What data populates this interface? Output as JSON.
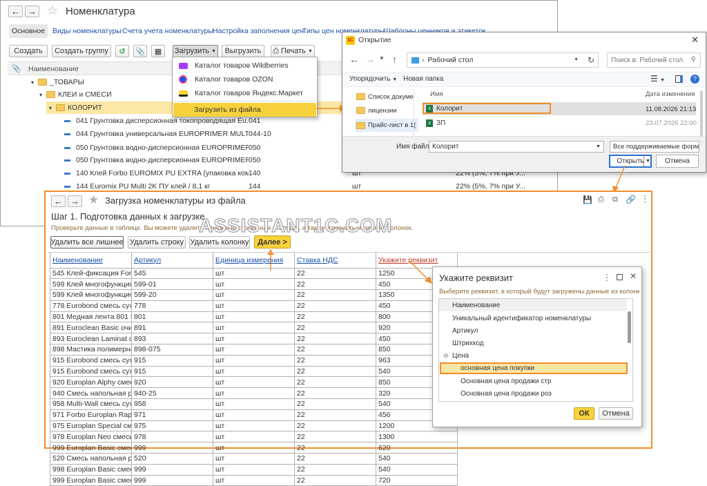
{
  "main": {
    "title": "Номенклатура",
    "tabs": [
      "Основное",
      "Виды номенклатуры",
      "Счета учета номенклатуры",
      "Настройка заполнения цен",
      "Типы цен номенклатуры",
      "Шаблоны ценников и этикеток"
    ],
    "toolbar": {
      "create": "Создать",
      "create_group": "Создать группу",
      "load": "Загрузить",
      "unload": "Выгрузить",
      "print": "Печать"
    },
    "column_name": "Наименование",
    "tree": [
      {
        "label": "_ТОВАРЫ",
        "level": 0
      },
      {
        "label": "КЛЕИ и СМЕСИ",
        "level": 1
      },
      {
        "label": "КОЛОРИТ",
        "level": 2
      }
    ],
    "items": [
      {
        "name": "041 Грунтовка дисперсионная токопроводящая  Eu...",
        "code": "041",
        "unit": "",
        "vat": ""
      },
      {
        "name": "044 Грунтовка универсальная EUROPRIMER MULTI ...",
        "code": "044-10",
        "unit": "",
        "vat": ""
      },
      {
        "name": "050 Грунтовка водно-дисперсионная EUROPRIMER...",
        "code": "050",
        "unit": "",
        "vat": ""
      },
      {
        "name": "050 Грунтовка водно-дисперсионная EUROPRIMER...",
        "code": "050",
        "unit": "",
        "vat": ""
      },
      {
        "name": "140 Клей Forbo EUROMIX PU EXTRA (упаковка  ком...",
        "code": "140",
        "unit": "шт",
        "vat": "22% (5%, 7% при У..."
      },
      {
        "name": "144 Euromix PU Multi 2K ПУ клей / 8,1 кг",
        "code": "144",
        "unit": "шт",
        "vat": "22% (5%, 7% при У..."
      }
    ]
  },
  "load_menu": {
    "items": [
      "Каталог товаров Wildberries",
      "Каталог товаров OZON",
      "Каталог товаров Яндекс.Маркет"
    ],
    "from_file": "Загрузить из файла"
  },
  "open_dialog": {
    "title": "Открытие",
    "path": "Рабочий стол",
    "search_placeholder": "Поиск в: Рабочий стол",
    "organize": "Упорядочить",
    "new_folder": "Новая папка",
    "nav": [
      "Список докуме",
      "лицензии",
      "Прайс-лист в 1("
    ],
    "col_name": "Имя",
    "col_date": "Дата изменения",
    "files": [
      {
        "name": "Колорит",
        "date": "11.08.2026 21:13"
      },
      {
        "name": "ЗП",
        "date": "23.07.2026 22:00"
      }
    ],
    "filename_label": "Имя файла:",
    "filename_value": "Колорит",
    "filter": "Все поддерживаемые форматы",
    "open": "Открыть",
    "cancel": "Отмена"
  },
  "load_window": {
    "title": "Загрузка номенклатуры из файла",
    "step": "Шаг 1. Подготовка данных к загрузке",
    "hint": "Проверьте данные в таблице. Вы можете удалить ненужные строки или столбцы, а также изменить названия колонок.",
    "buttons": {
      "remove_all": "Удалить все лишнее",
      "remove_row": "Удалить строку",
      "remove_col": "Удалить колонку",
      "next": "Далее >"
    },
    "columns": [
      "Наименование",
      "Артикул",
      "Единица измерения",
      "Ставка НДС",
      "Укажите реквизит"
    ],
    "rows": [
      [
        "545 Клей-фиксация Forbo",
        "545",
        "шт",
        "22",
        "1250"
      ],
      [
        "599 Клей многофункциона",
        "599-01",
        "шт",
        "22",
        "450"
      ],
      [
        "599 Клей многофункциона",
        "599-20",
        "шт",
        "22",
        "1350"
      ],
      [
        "778 Eurobond смесь сухая",
        "778",
        "шт",
        "22",
        "450"
      ],
      [
        "801 Медная лента 801  ME",
        "801",
        "шт",
        "22",
        "800"
      ],
      [
        "891 Euroclean Basic очист",
        "891",
        "шт",
        "22",
        "920"
      ],
      [
        "893 Euroclean Laminat сред",
        "893",
        "шт",
        "22",
        "450"
      ],
      [
        "898 Мастика полимерная м",
        "898-075",
        "шт",
        "22",
        "850"
      ],
      [
        "915 Eurobond смесь сухая",
        "915",
        "шт",
        "22",
        "963"
      ],
      [
        "915 Eurobond смесь сухая",
        "915",
        "шт",
        "22",
        "540"
      ],
      [
        "920 Europlan Alphy смесь с",
        "920",
        "шт",
        "22",
        "850"
      ],
      [
        "940 Смесь напольная реме",
        "940-25",
        "шт",
        "22",
        "320"
      ],
      [
        "958 Multi-Wall смесь сухая",
        "958",
        "шт",
        "22",
        "540"
      ],
      [
        "971  Forbo Europlan Rapid с",
        "971",
        "шт",
        "22",
        "456"
      ],
      [
        "975 Europlan Special смесь",
        "975",
        "шт",
        "22",
        "1200"
      ],
      [
        "978 Europlan Neo смесь су",
        "978",
        "шт",
        "22",
        "1300"
      ],
      [
        "999 Europlan Basic смесь с",
        "999",
        "шт",
        "22",
        "620"
      ],
      [
        "520 Смесь напольная реме",
        "520",
        "шт",
        "22",
        "540"
      ],
      [
        "998 Europlan Basic смесь с",
        "999",
        "шт",
        "22",
        "540"
      ],
      [
        "999 Europlan Basic смесь с",
        "999",
        "шт",
        "22",
        "720"
      ]
    ]
  },
  "attr_dialog": {
    "title": "Укажите реквизит",
    "hint": "Выберите реквизит, в который будут загружены данные из колонки",
    "items": [
      "Наименование",
      "Уникальный идентификатор номенклатуры",
      "Артикул",
      "Штрихкод",
      "Цена",
      "основная цена покупки",
      "Основная цена продажи стр",
      "Основная цена продажи роз"
    ],
    "ok": "ОК",
    "cancel": "Отмена"
  },
  "watermark": "ASSISTANT1C.COM",
  "colors": {
    "accent": "#f08c28",
    "highlight": "#f8d23c",
    "link": "#1a4fa8"
  }
}
